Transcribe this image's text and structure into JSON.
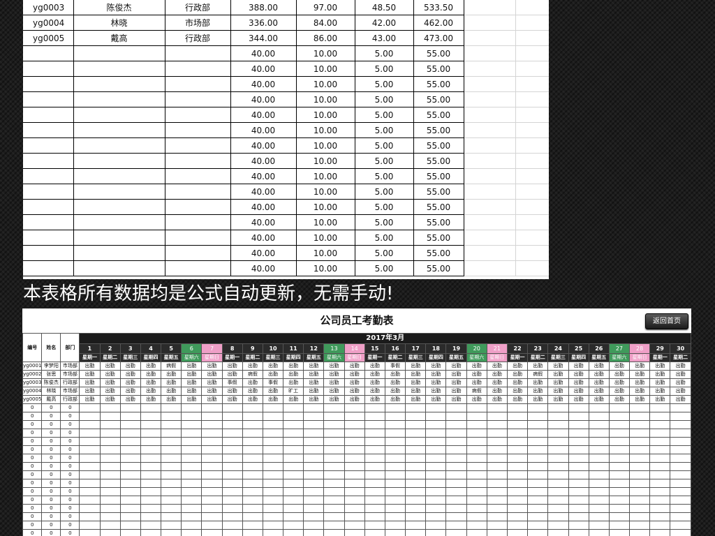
{
  "top_table": {
    "rows": [
      [
        "yg0003",
        "陈俊杰",
        "行政部",
        "388.00",
        "97.00",
        "48.50",
        "533.50"
      ],
      [
        "yg0004",
        "林晓",
        "市场部",
        "336.00",
        "84.00",
        "42.00",
        "462.00"
      ],
      [
        "yg0005",
        "戴高",
        "行政部",
        "344.00",
        "86.00",
        "43.00",
        "473.00"
      ],
      [
        "",
        "",
        "",
        "40.00",
        "10.00",
        "5.00",
        "55.00"
      ],
      [
        "",
        "",
        "",
        "40.00",
        "10.00",
        "5.00",
        "55.00"
      ],
      [
        "",
        "",
        "",
        "40.00",
        "10.00",
        "5.00",
        "55.00"
      ],
      [
        "",
        "",
        "",
        "40.00",
        "10.00",
        "5.00",
        "55.00"
      ],
      [
        "",
        "",
        "",
        "40.00",
        "10.00",
        "5.00",
        "55.00"
      ],
      [
        "",
        "",
        "",
        "40.00",
        "10.00",
        "5.00",
        "55.00"
      ],
      [
        "",
        "",
        "",
        "40.00",
        "10.00",
        "5.00",
        "55.00"
      ],
      [
        "",
        "",
        "",
        "40.00",
        "10.00",
        "5.00",
        "55.00"
      ],
      [
        "",
        "",
        "",
        "40.00",
        "10.00",
        "5.00",
        "55.00"
      ],
      [
        "",
        "",
        "",
        "40.00",
        "10.00",
        "5.00",
        "55.00"
      ],
      [
        "",
        "",
        "",
        "40.00",
        "10.00",
        "5.00",
        "55.00"
      ],
      [
        "",
        "",
        "",
        "40.00",
        "10.00",
        "5.00",
        "55.00"
      ],
      [
        "",
        "",
        "",
        "40.00",
        "10.00",
        "5.00",
        "55.00"
      ],
      [
        "",
        "",
        "",
        "40.00",
        "10.00",
        "5.00",
        "55.00"
      ],
      [
        "",
        "",
        "",
        "40.00",
        "10.00",
        "5.00",
        "55.00"
      ]
    ]
  },
  "caption": "本表格所有数据均是公式自动更新，无需手动!",
  "attendance": {
    "title": "公司员工考勤表",
    "back_button": "返回首页",
    "month": "2017年3月",
    "header_labels": [
      "编号",
      "姓名",
      "部门"
    ],
    "days": [
      "1",
      "2",
      "3",
      "4",
      "5",
      "6",
      "7",
      "8",
      "9",
      "10",
      "11",
      "12",
      "13",
      "14",
      "15",
      "16",
      "17",
      "18",
      "19",
      "20",
      "21",
      "22",
      "23",
      "24",
      "25",
      "26",
      "27",
      "28",
      "29",
      "30"
    ],
    "weekdays": [
      "星期一",
      "星期二",
      "星期三",
      "星期四",
      "星期五",
      "星期六",
      "星期日",
      "星期一",
      "星期二",
      "星期三",
      "星期四",
      "星期五",
      "星期六",
      "星期日",
      "星期一",
      "星期二",
      "星期三",
      "星期四",
      "星期五",
      "星期六",
      "星期日",
      "星期一",
      "星期二",
      "星期三",
      "星期四",
      "星期五",
      "星期六",
      "星期日",
      "星期一",
      "星期二"
    ],
    "employees": [
      {
        "id": "yg0001",
        "name": "李梦阳",
        "dept": "市场部",
        "status": [
          "出勤",
          "出勤",
          "出勤",
          "出勤",
          "病假",
          "出勤",
          "出勤",
          "出勤",
          "出勤",
          "出勤",
          "出勤",
          "出勤",
          "出勤",
          "出勤",
          "出勤",
          "事假",
          "出勤",
          "出勤",
          "出勤",
          "出勤",
          "出勤",
          "出勤",
          "出勤",
          "出勤",
          "出勤",
          "出勤",
          "出勤",
          "出勤",
          "出勤",
          "出勤"
        ]
      },
      {
        "id": "yg0002",
        "name": "张思",
        "dept": "市场部",
        "status": [
          "出勤",
          "出勤",
          "出勤",
          "出勤",
          "出勤",
          "出勤",
          "出勤",
          "出勤",
          "病假",
          "出勤",
          "出勤",
          "出勤",
          "出勤",
          "出勤",
          "出勤",
          "出勤",
          "出勤",
          "出勤",
          "出勤",
          "出勤",
          "出勤",
          "出勤",
          "病假",
          "出勤",
          "出勤",
          "出勤",
          "出勤",
          "出勤",
          "出勤",
          "出勤"
        ]
      },
      {
        "id": "yg0003",
        "name": "陈俊杰",
        "dept": "行政部",
        "status": [
          "出勤",
          "出勤",
          "出勤",
          "出勤",
          "出勤",
          "出勤",
          "出勤",
          "事假",
          "出勤",
          "事假",
          "出勤",
          "出勤",
          "出勤",
          "出勤",
          "出勤",
          "出勤",
          "出勤",
          "出勤",
          "出勤",
          "出勤",
          "出勤",
          "出勤",
          "出勤",
          "出勤",
          "出勤",
          "出勤",
          "出勤",
          "出勤",
          "出勤",
          "出勤"
        ]
      },
      {
        "id": "yg0004",
        "name": "林晓",
        "dept": "市场部",
        "status": [
          "出勤",
          "出勤",
          "出勤",
          "出勤",
          "出勤",
          "出勤",
          "出勤",
          "出勤",
          "出勤",
          "出勤",
          "旷工",
          "出勤",
          "出勤",
          "出勤",
          "出勤",
          "出勤",
          "出勤",
          "出勤",
          "出勤",
          "病假",
          "出勤",
          "出勤",
          "出勤",
          "出勤",
          "出勤",
          "出勤",
          "出勤",
          "出勤",
          "出勤",
          "出勤"
        ]
      },
      {
        "id": "yg0005",
        "name": "戴高",
        "dept": "行政部",
        "status": [
          "出勤",
          "出勤",
          "出勤",
          "出勤",
          "出勤",
          "出勤",
          "出勤",
          "出勤",
          "出勤",
          "出勤",
          "出勤",
          "出勤",
          "出勤",
          "出勤",
          "出勤",
          "出勤",
          "出勤",
          "出勤",
          "出勤",
          "出勤",
          "出勤",
          "出勤",
          "出勤",
          "出勤",
          "出勤",
          "出勤",
          "出勤",
          "出勤",
          "出勤",
          "出勤"
        ]
      }
    ],
    "empty_rows": [
      [
        "0",
        "0",
        "0"
      ],
      [
        "0",
        "0",
        "0"
      ],
      [
        "0",
        "0",
        "0"
      ],
      [
        "0",
        "0",
        "0"
      ],
      [
        "0",
        "0",
        "0"
      ],
      [
        "0",
        "0",
        "0"
      ],
      [
        "0",
        "0",
        "0"
      ],
      [
        "0",
        "0",
        "0"
      ],
      [
        "0",
        "0",
        "0"
      ],
      [
        "0",
        "0",
        "0"
      ],
      [
        "0",
        "0",
        "0"
      ],
      [
        "0",
        "0",
        "0"
      ],
      [
        "0",
        "0",
        "0"
      ],
      [
        "0",
        "0",
        "0"
      ],
      [
        "0",
        "0",
        "0"
      ],
      [
        "0",
        "0",
        "0"
      ]
    ]
  }
}
